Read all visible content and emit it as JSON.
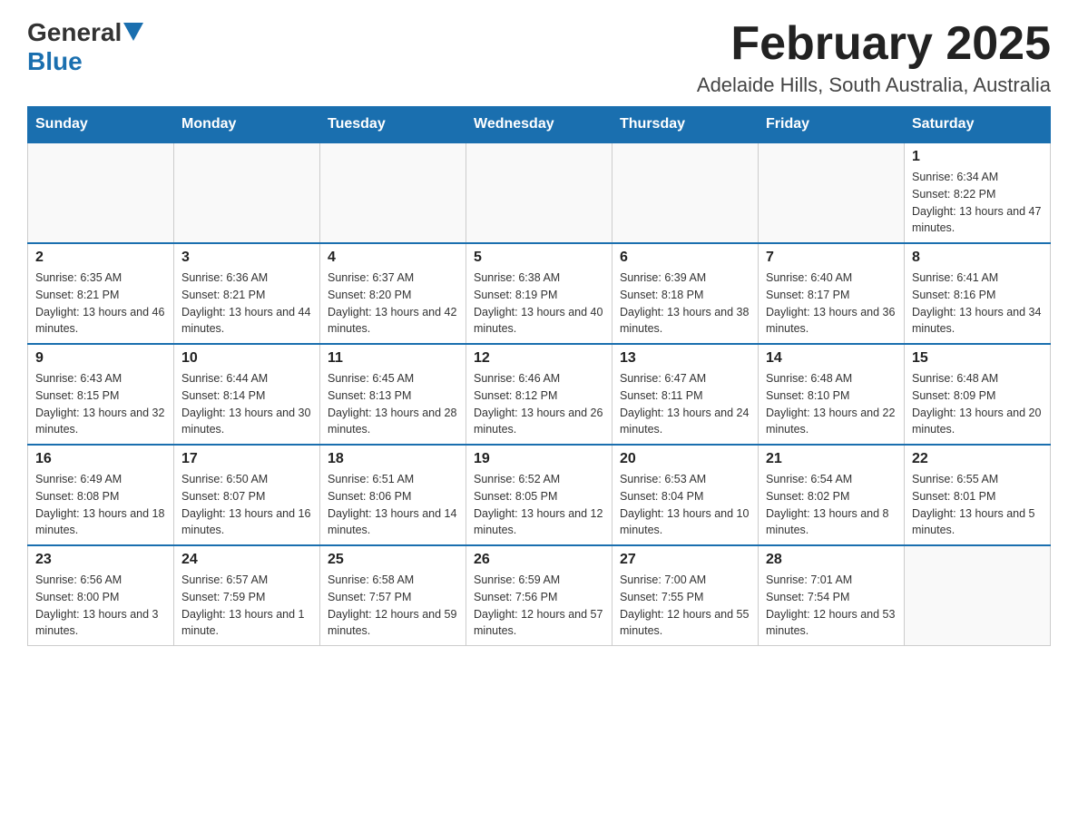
{
  "header": {
    "logo": {
      "general": "General",
      "blue": "Blue",
      "triangle_color": "#1a6faf"
    },
    "title": "February 2025",
    "subtitle": "Adelaide Hills, South Australia, Australia"
  },
  "calendar": {
    "days_of_week": [
      "Sunday",
      "Monday",
      "Tuesday",
      "Wednesday",
      "Thursday",
      "Friday",
      "Saturday"
    ],
    "weeks": [
      [
        {
          "day": "",
          "info": ""
        },
        {
          "day": "",
          "info": ""
        },
        {
          "day": "",
          "info": ""
        },
        {
          "day": "",
          "info": ""
        },
        {
          "day": "",
          "info": ""
        },
        {
          "day": "",
          "info": ""
        },
        {
          "day": "1",
          "info": "Sunrise: 6:34 AM\nSunset: 8:22 PM\nDaylight: 13 hours and 47 minutes."
        }
      ],
      [
        {
          "day": "2",
          "info": "Sunrise: 6:35 AM\nSunset: 8:21 PM\nDaylight: 13 hours and 46 minutes."
        },
        {
          "day": "3",
          "info": "Sunrise: 6:36 AM\nSunset: 8:21 PM\nDaylight: 13 hours and 44 minutes."
        },
        {
          "day": "4",
          "info": "Sunrise: 6:37 AM\nSunset: 8:20 PM\nDaylight: 13 hours and 42 minutes."
        },
        {
          "day": "5",
          "info": "Sunrise: 6:38 AM\nSunset: 8:19 PM\nDaylight: 13 hours and 40 minutes."
        },
        {
          "day": "6",
          "info": "Sunrise: 6:39 AM\nSunset: 8:18 PM\nDaylight: 13 hours and 38 minutes."
        },
        {
          "day": "7",
          "info": "Sunrise: 6:40 AM\nSunset: 8:17 PM\nDaylight: 13 hours and 36 minutes."
        },
        {
          "day": "8",
          "info": "Sunrise: 6:41 AM\nSunset: 8:16 PM\nDaylight: 13 hours and 34 minutes."
        }
      ],
      [
        {
          "day": "9",
          "info": "Sunrise: 6:43 AM\nSunset: 8:15 PM\nDaylight: 13 hours and 32 minutes."
        },
        {
          "day": "10",
          "info": "Sunrise: 6:44 AM\nSunset: 8:14 PM\nDaylight: 13 hours and 30 minutes."
        },
        {
          "day": "11",
          "info": "Sunrise: 6:45 AM\nSunset: 8:13 PM\nDaylight: 13 hours and 28 minutes."
        },
        {
          "day": "12",
          "info": "Sunrise: 6:46 AM\nSunset: 8:12 PM\nDaylight: 13 hours and 26 minutes."
        },
        {
          "day": "13",
          "info": "Sunrise: 6:47 AM\nSunset: 8:11 PM\nDaylight: 13 hours and 24 minutes."
        },
        {
          "day": "14",
          "info": "Sunrise: 6:48 AM\nSunset: 8:10 PM\nDaylight: 13 hours and 22 minutes."
        },
        {
          "day": "15",
          "info": "Sunrise: 6:48 AM\nSunset: 8:09 PM\nDaylight: 13 hours and 20 minutes."
        }
      ],
      [
        {
          "day": "16",
          "info": "Sunrise: 6:49 AM\nSunset: 8:08 PM\nDaylight: 13 hours and 18 minutes."
        },
        {
          "day": "17",
          "info": "Sunrise: 6:50 AM\nSunset: 8:07 PM\nDaylight: 13 hours and 16 minutes."
        },
        {
          "day": "18",
          "info": "Sunrise: 6:51 AM\nSunset: 8:06 PM\nDaylight: 13 hours and 14 minutes."
        },
        {
          "day": "19",
          "info": "Sunrise: 6:52 AM\nSunset: 8:05 PM\nDaylight: 13 hours and 12 minutes."
        },
        {
          "day": "20",
          "info": "Sunrise: 6:53 AM\nSunset: 8:04 PM\nDaylight: 13 hours and 10 minutes."
        },
        {
          "day": "21",
          "info": "Sunrise: 6:54 AM\nSunset: 8:02 PM\nDaylight: 13 hours and 8 minutes."
        },
        {
          "day": "22",
          "info": "Sunrise: 6:55 AM\nSunset: 8:01 PM\nDaylight: 13 hours and 5 minutes."
        }
      ],
      [
        {
          "day": "23",
          "info": "Sunrise: 6:56 AM\nSunset: 8:00 PM\nDaylight: 13 hours and 3 minutes."
        },
        {
          "day": "24",
          "info": "Sunrise: 6:57 AM\nSunset: 7:59 PM\nDaylight: 13 hours and 1 minute."
        },
        {
          "day": "25",
          "info": "Sunrise: 6:58 AM\nSunset: 7:57 PM\nDaylight: 12 hours and 59 minutes."
        },
        {
          "day": "26",
          "info": "Sunrise: 6:59 AM\nSunset: 7:56 PM\nDaylight: 12 hours and 57 minutes."
        },
        {
          "day": "27",
          "info": "Sunrise: 7:00 AM\nSunset: 7:55 PM\nDaylight: 12 hours and 55 minutes."
        },
        {
          "day": "28",
          "info": "Sunrise: 7:01 AM\nSunset: 7:54 PM\nDaylight: 12 hours and 53 minutes."
        },
        {
          "day": "",
          "info": ""
        }
      ]
    ]
  }
}
